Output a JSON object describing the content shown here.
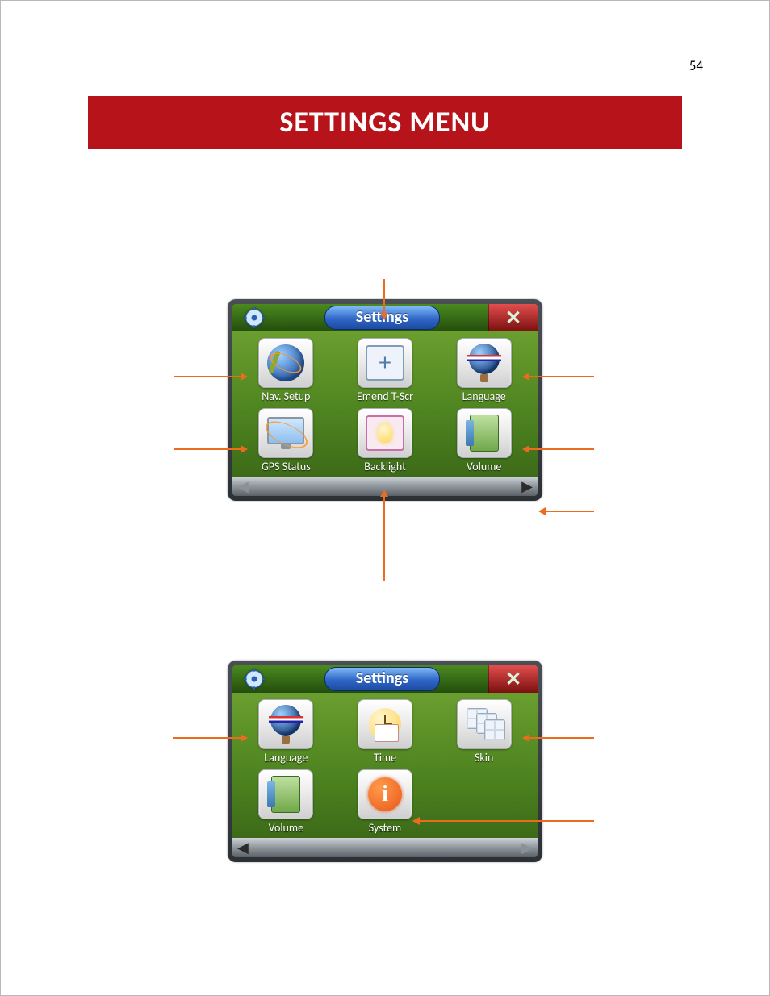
{
  "page_number": "54",
  "title": "SETTINGS MENU",
  "screen1": {
    "header_title": "Settings",
    "tiles": [
      {
        "label": "Nav. Setup"
      },
      {
        "label": "Emend T-Scr"
      },
      {
        "label": "Language"
      },
      {
        "label": "GPS Status"
      },
      {
        "label": "Backlight"
      },
      {
        "label": "Volume"
      }
    ]
  },
  "screen2": {
    "header_title": "Settings",
    "tiles": [
      {
        "label": "Language"
      },
      {
        "label": "Time"
      },
      {
        "label": "Skin"
      },
      {
        "label": "Volume"
      },
      {
        "label": "System"
      }
    ]
  }
}
